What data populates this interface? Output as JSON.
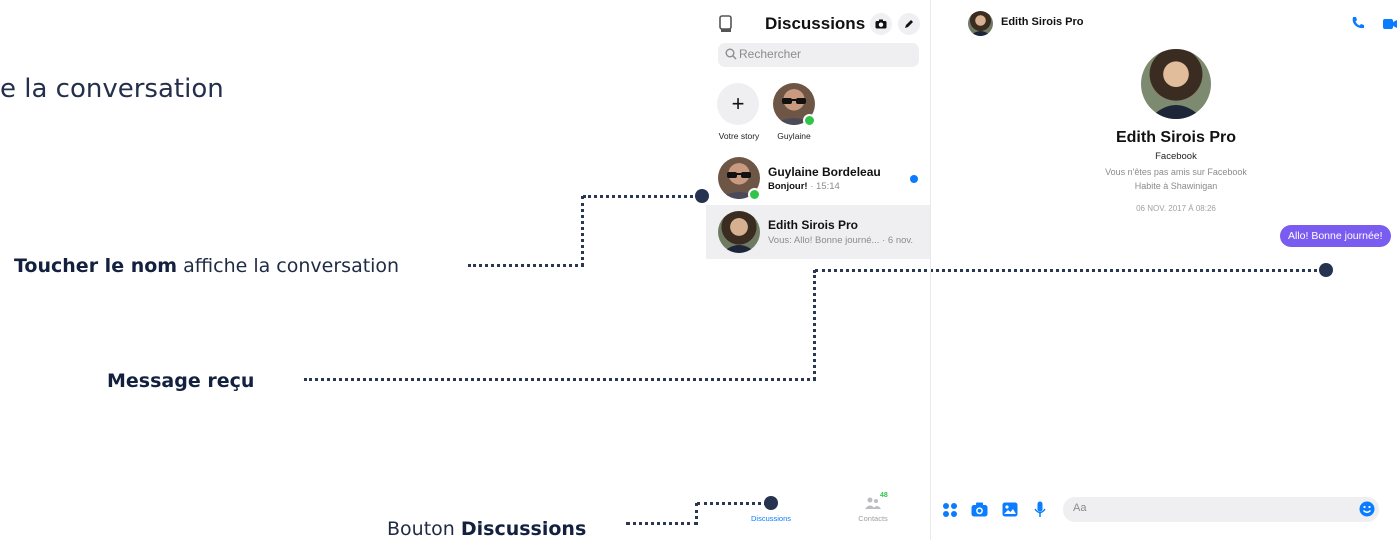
{
  "captions": {
    "top_partial": "e la conversation",
    "touch_name_bold": "Toucher le nom",
    "touch_name_rest": " affiche la conversation",
    "message_received": "Message reçu",
    "button_prefix": "Bouton ",
    "button_bold": "Discussions"
  },
  "sidebar": {
    "title": "Discussions",
    "search_placeholder": "Rechercher",
    "stories": [
      {
        "label": "Votre story"
      },
      {
        "label": "Guylaine"
      }
    ],
    "conversations": [
      {
        "name": "Guylaine Bordeleau",
        "preview": "Bonjour!",
        "time": "· 15:14",
        "unread": true
      },
      {
        "name": "Edith Sirois Pro",
        "preview": "Vous: Allo! Bonne journé...",
        "time": "· 6 nov.",
        "selected": true
      }
    ],
    "bottom_tabs": [
      {
        "label": "Discussions",
        "active": true
      },
      {
        "label": "Contacts",
        "badge": "48"
      }
    ]
  },
  "chat": {
    "header_name": "Edith Sirois Pro",
    "profile_name": "Edith Sirois Pro",
    "profile_source": "Facebook",
    "profile_friend_status": "Vous n'êtes pas amis sur Facebook",
    "profile_location": "Habite à Shawinigan",
    "timestamp": "06 NOV. 2017 À 08:26",
    "message_bubble": "Allo! Bonne journée!",
    "composer_placeholder": "Aa"
  },
  "colors": {
    "accent": "#0a7cff",
    "bubble": "#7a5cf0",
    "online": "#31c34a",
    "caption": "#1f2a44",
    "callout": "#253250"
  }
}
